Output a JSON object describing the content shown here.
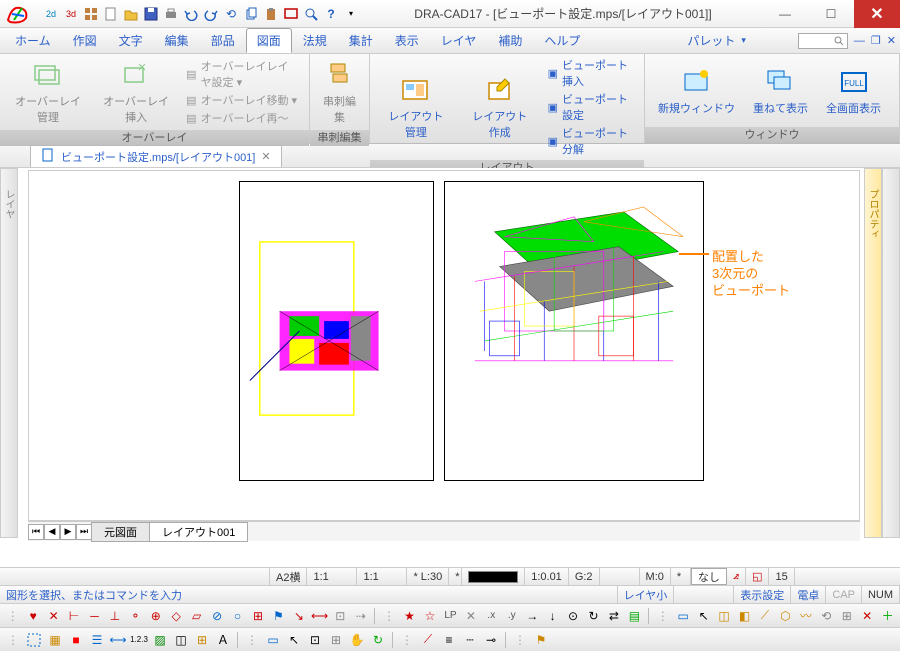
{
  "window": {
    "title": "DRA-CAD17 - [ビューポート設定.mps/[レイアウト001]]"
  },
  "menu": {
    "tabs": [
      "ホーム",
      "作図",
      "文字",
      "編集",
      "部品",
      "図面",
      "法規",
      "集計",
      "表示",
      "レイヤ",
      "補助",
      "ヘルプ"
    ],
    "active": 5,
    "palette": "パレット"
  },
  "ribbon": {
    "groups": [
      {
        "title": "オーバーレイ",
        "overlay_mgmt": "オーバーレイ管理",
        "overlay_insert": "オーバーレイ挿入",
        "layer_set": "オーバーレイレイヤ設定 ▾",
        "move": "オーバーレイ移動 ▾",
        "reload": "オーバーレイ再〜"
      },
      {
        "title": "串刺編集",
        "btn": "串刺編集"
      },
      {
        "title": "レイアウト",
        "layout_mgmt": "レイアウト管理",
        "layout_create": "レイアウト作成",
        "vp_insert": "ビューポート挿入",
        "vp_set": "ビューポート設定",
        "vp_split": "ビューポート分解"
      },
      {
        "title": "ウィンドウ",
        "new_win": "新規ウィンドウ",
        "cascade": "重ねて表示",
        "full": "全画面表示"
      }
    ]
  },
  "doc_tab": {
    "label": "ビューポート設定.mps/[レイアウト001]"
  },
  "layout_tabs": {
    "original": "元図面",
    "layout": "レイアウト001"
  },
  "annotation": {
    "l1": "配置した",
    "l2": "3次元の",
    "l3": "ビューポート"
  },
  "status1": {
    "paper": "A2横",
    "s1": "1:1",
    "s2": "1:1",
    "layer": "*  L:30",
    "ratio": "1:0.01",
    "g": "G:2",
    "m": "M:0",
    "none": "なし",
    "num": "15"
  },
  "status2": {
    "prompt": "図形を選択、またはコマンドを入力",
    "layer_small": "レイヤ小",
    "disp_set": "表示設定",
    "calc": "電卓",
    "cap": "CAP",
    "num": "NUM"
  },
  "side": {
    "left": "レイヤ",
    "right": "プロパティ"
  },
  "tb_labels": {
    "lp": "LP",
    "x": ".x",
    "y": ".y"
  }
}
